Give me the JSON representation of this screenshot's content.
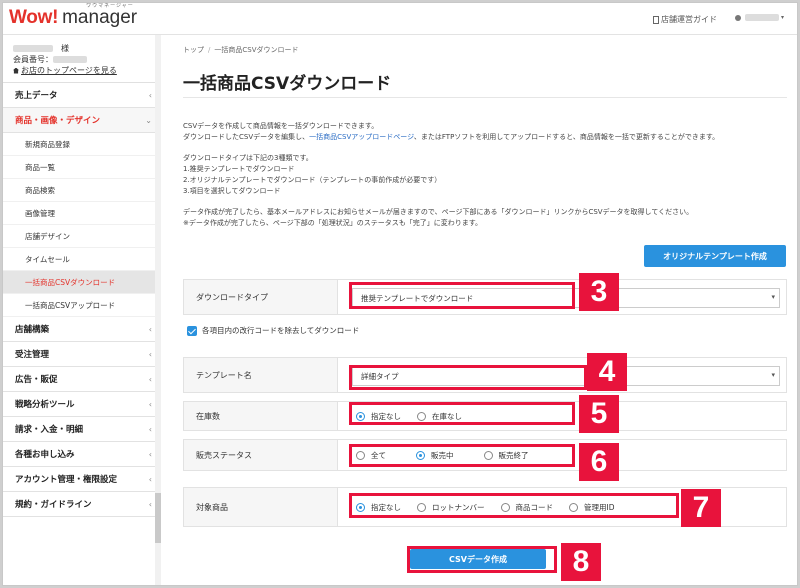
{
  "header": {
    "logo_wow": "Wow!",
    "logo_manager": "manager",
    "logo_kana": "ワウマネージャー",
    "guide_link": "店舗運営ガイド"
  },
  "sidebar": {
    "user_suffix": "様",
    "member_label": "会員番号：",
    "shop_top_link": "お店のトップページを見る",
    "menu": [
      {
        "label": "売上データ"
      },
      {
        "label": "商品・画像・デザイン",
        "active": true
      },
      {
        "label": "店舗構築"
      },
      {
        "label": "受注管理"
      },
      {
        "label": "広告・販促"
      },
      {
        "label": "戦略分析ツール"
      },
      {
        "label": "請求・入金・明細"
      },
      {
        "label": "各種お申し込み"
      },
      {
        "label": "アカウント管理・権限設定"
      },
      {
        "label": "規約・ガイドライン"
      }
    ],
    "submenu": [
      {
        "label": "新規商品登録"
      },
      {
        "label": "商品一覧"
      },
      {
        "label": "商品検索"
      },
      {
        "label": "画像管理"
      },
      {
        "label": "店舗デザイン"
      },
      {
        "label": "タイムセール"
      },
      {
        "label": "一括商品CSVダウンロード",
        "active": true
      },
      {
        "label": "一括商品CSVアップロード"
      }
    ]
  },
  "breadcrumb": [
    "トップ",
    "一括商品CSVダウンロード"
  ],
  "page_title": "一括商品CSVダウンロード",
  "description": {
    "p1_line1": "CSVデータを作成して商品情報を一括ダウンロードできます。",
    "p1_line2_a": "ダウンロードしたCSVデータを編集し、",
    "p1_line2_link": "一括商品CSVアップロードページ",
    "p1_line2_b": "、またはFTPソフトを利用してアップロードすると、商品情報を一括で更新することができます。",
    "types_intro": "ダウンロードタイプは下記の3種類です。",
    "type1": "1.推奨テンプレートでダウンロード",
    "type2": "2.オリジナルテンプレートでダウンロード（テンプレートの事前作成が必要です）",
    "type3": "3.項目を選択してダウンロード",
    "note1": "データ作成が完了したら、基本メールアドレスにお知らせメールが届きますので、ページ下部にある「ダウンロード」リンクからCSVデータを取得してください。",
    "note2": "※データ作成が完了したら、ページ下部の「処理状況」のステータスも「完了」に変わります。"
  },
  "buttons": {
    "original_template": "オリジナルテンプレート作成",
    "create_csv": "CSVデータ作成"
  },
  "form": {
    "download_type": {
      "label": "ダウンロードタイプ",
      "value": "推奨テンプレートでダウンロード"
    },
    "remove_linebreak": {
      "label": "各項目内の改行コードを除去してダウンロード",
      "checked": true
    },
    "template_name": {
      "label": "テンプレート名",
      "value": "詳細タイプ"
    },
    "stock": {
      "label": "在庫数",
      "options": [
        "指定なし",
        "在庫なし"
      ],
      "selected": 0
    },
    "sales_status": {
      "label": "販売ステータス",
      "options": [
        "全て",
        "販売中",
        "販売終了"
      ],
      "selected": 1
    },
    "target": {
      "label": "対象商品",
      "options": [
        "指定なし",
        "ロットナンバー",
        "商品コード",
        "管理用ID"
      ],
      "selected": 0
    }
  },
  "callouts": [
    "3",
    "4",
    "5",
    "6",
    "7",
    "8"
  ],
  "colors": {
    "accent_blue": "#2a92de",
    "brand_red": "#e4322b",
    "callout_red": "#e8133c"
  }
}
